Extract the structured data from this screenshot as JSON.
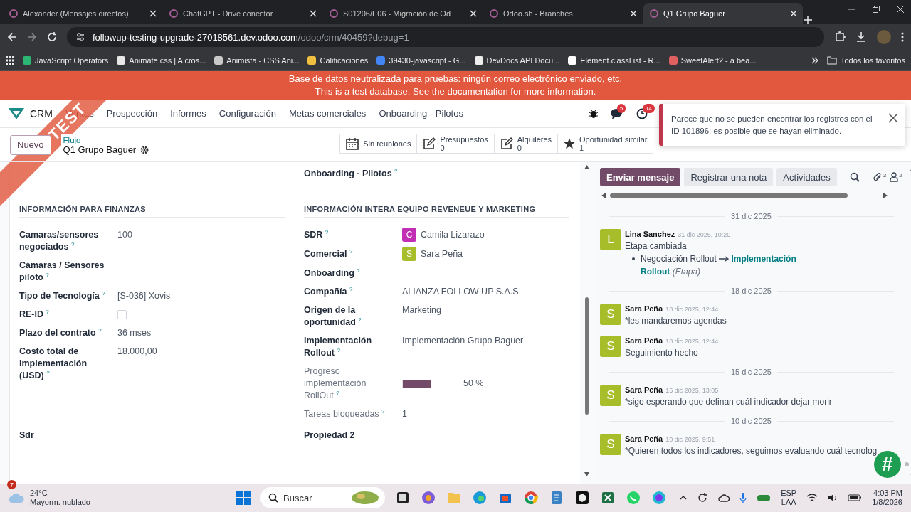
{
  "browser": {
    "tabs": [
      {
        "title": "Alexander (Mensajes directos)",
        "selected": false
      },
      {
        "title": "ChatGPT - Drive conector",
        "selected": false
      },
      {
        "title": "S01206/E06 - Migración de Od",
        "selected": false
      },
      {
        "title": "Odoo.sh - Branches",
        "selected": false
      },
      {
        "title": "Q1 Grupo Baguer",
        "selected": true
      }
    ],
    "url": {
      "host": "followup-testing-upgrade-27018561.dev.odoo.com",
      "path": "/odoo/crm/40459?debug=1"
    },
    "bookmarks": [
      "JavaScript Operators",
      "Animate.css | A cros...",
      "Animista - CSS Ani...",
      "Calificaciones",
      "39430-javascript - G...",
      "DevDocs API Docu...",
      "Element.classList - R...",
      "SweetAlert2 - a bea..."
    ],
    "all_bookmarks": "Todos los favoritos"
  },
  "banner": {
    "line_1": "Base de datos neutralizada para pruebas: ningún correo electrónico enviado, etc.",
    "line_2": "This is a test database.",
    "link": "See the documentation for more information."
  },
  "ribbon": "TEST",
  "navbar": {
    "app": "CRM",
    "menu": [
      "Ventas",
      "Prospección",
      "Informes",
      "Configuración",
      "Metas comerciales",
      "Onboarding - Pilotos"
    ],
    "messages_badge": "5",
    "activities_badge": "14"
  },
  "control_panel": {
    "new_button": "Nuevo",
    "breadcrumb": "Flujo",
    "record_title": "Q1 Grupo Baguer",
    "smart_buttons": [
      {
        "kind": "calendar",
        "label": "Sin reuniones"
      },
      {
        "kind": "edit",
        "label": "Presupuestos",
        "count": "0"
      },
      {
        "kind": "edit",
        "label": "Alquileres",
        "count": "0"
      },
      {
        "kind": "star",
        "label": "Oportunidad similar",
        "count": "1"
      }
    ]
  },
  "toast": {
    "message": "Parece que no se pueden encontrar los registros con el ID 101896; es posible que se hayan eliminado."
  },
  "form": {
    "columns": [
      {
        "section": {
          "title": "INFORMACIÓN PARA FINANZAS",
          "fields": [
            {
              "label": "Camaras/sensores negociados $^{?}$",
              "kind": "text",
              "readonly": false,
              "value": "100"
            },
            {
              "label": "Cámaras / Sensores piloto $^{?}$",
              "readonly": false
            },
            {
              "label": "Tipo de Tecnología $^{?}$",
              "kind": "text",
              "readonly": false,
              "value": "[S-036] Xovis"
            },
            {
              "label": "RE-ID $^{?}$",
              "kind": "checkbox",
              "readonly": false,
              "checked": false
            },
            {
              "label": "Plazo del contrato $^{?}$",
              "kind": "text",
              "readonly": false,
              "value": "36 mses"
            },
            {
              "label": "Costo total de implementación (USD) $^{?}$",
              "kind": "text",
              "readonly": false,
              "value": "18.000,00"
            }
          ]
        },
        "footer_fields": [
          {
            "label": "Sdr",
            "readonly": false
          }
        ]
      },
      {
        "header_fields": [
          {
            "label": "Onboarding - Pilotos $^{?}$",
            "readonly": false
          }
        ],
        "section": {
          "title": "INFORMACIÓN INTERA EQUIPO REVENEUE Y MARKETING",
          "fields": [
            {
              "label": "SDR $^{?}$",
              "kind": "avatar",
              "readonly": false,
              "initial": "C",
              "color": "#c22fb4",
              "value": "Camila Lizarazo"
            },
            {
              "label": "Comercial $^{?}$",
              "kind": "avatar",
              "readonly": false,
              "initial": "S",
              "color": "#a8bd2a",
              "value": "Sara Peña"
            },
            {
              "label": "Onboarding $^{?}$",
              "readonly": false
            },
            {
              "label": "Compañía $^{?}$",
              "kind": "text",
              "readonly": false,
              "value": "ALIANZA FOLLOW UP S.A.S."
            },
            {
              "label": "Origen de la oportunidad $^{?}$",
              "kind": "text",
              "readonly": false,
              "value": "Marketing"
            },
            {
              "label": "Implementación Rollout $^{?}$",
              "kind": "text",
              "readonly": false,
              "value": "Implementación Grupo Baguer"
            },
            {
              "label": "Progreso implementación RollOut $^{?}$",
              "kind": "progress",
              "readonly": true,
              "level": 0.5,
              "reading": "50 %"
            },
            {
              "label": "Tareas bloqueadas $^{?}$",
              "kind": "text",
              "readonly": true,
              "value": "1"
            }
          ]
        },
        "footer_fields": [
          {
            "label": "Propiedad 2",
            "readonly": false
          }
        ]
      }
    ]
  },
  "chatter": {
    "buttons": [
      {
        "label": "Enviar mensaje",
        "selected": true
      },
      {
        "label": "Registrar una nota",
        "selected": false
      },
      {
        "label": "Actividades",
        "selected": false
      }
    ],
    "attachments_count": "3",
    "followers_count": "2",
    "thread": [
      {
        "kind": "date",
        "label": "31 dic 2025"
      },
      {
        "kind": "tracking",
        "author": "Lina Sanchez",
        "time": "31 dic 2025, 10:20",
        "initial": "L",
        "color": "#a8bd2a",
        "body": "Etapa cambiada",
        "old_value": "Negociación Rollout",
        "new_value": "Implementación Rollout",
        "field": "(Etapa)"
      },
      {
        "kind": "date",
        "label": "18 dic 2025"
      },
      {
        "kind": "message",
        "author": "Sara Peña",
        "time": "18 dic 2025, 12:44",
        "initial": "S",
        "color": "#a8bd2a",
        "body": "*les mandaremos agendas"
      },
      {
        "kind": "message",
        "author": "Sara Peña",
        "time": "18 dic 2025, 12:44",
        "initial": "S",
        "color": "#a8bd2a",
        "body": "Seguimiento hecho"
      },
      {
        "kind": "date",
        "label": "15 dic 2025"
      },
      {
        "kind": "message",
        "author": "Sara Peña",
        "time": "15 dic 2025, 13:05",
        "initial": "S",
        "color": "#a8bd2a",
        "body": "*sigo esperando que definan cuál indicador dejar morir"
      },
      {
        "kind": "date",
        "label": "10 dic 2025"
      },
      {
        "kind": "message",
        "author": "Sara Peña",
        "time": "10 dic 2025, 9:51",
        "initial": "S",
        "color": "#a8bd2a",
        "body": "*Quieren todos los indicadores, seguimos evaluando cuál tecnolog"
      }
    ],
    "floating_button": "#"
  },
  "taskbar": {
    "weather_badge": "7",
    "temperature": "24°C",
    "weather": "Mayorm. nublado",
    "search": {
      "placeholder": "Buscar"
    },
    "language": "ESP",
    "layout": "LAA",
    "time": "4:03 PM",
    "date": "1/8/2026"
  }
}
